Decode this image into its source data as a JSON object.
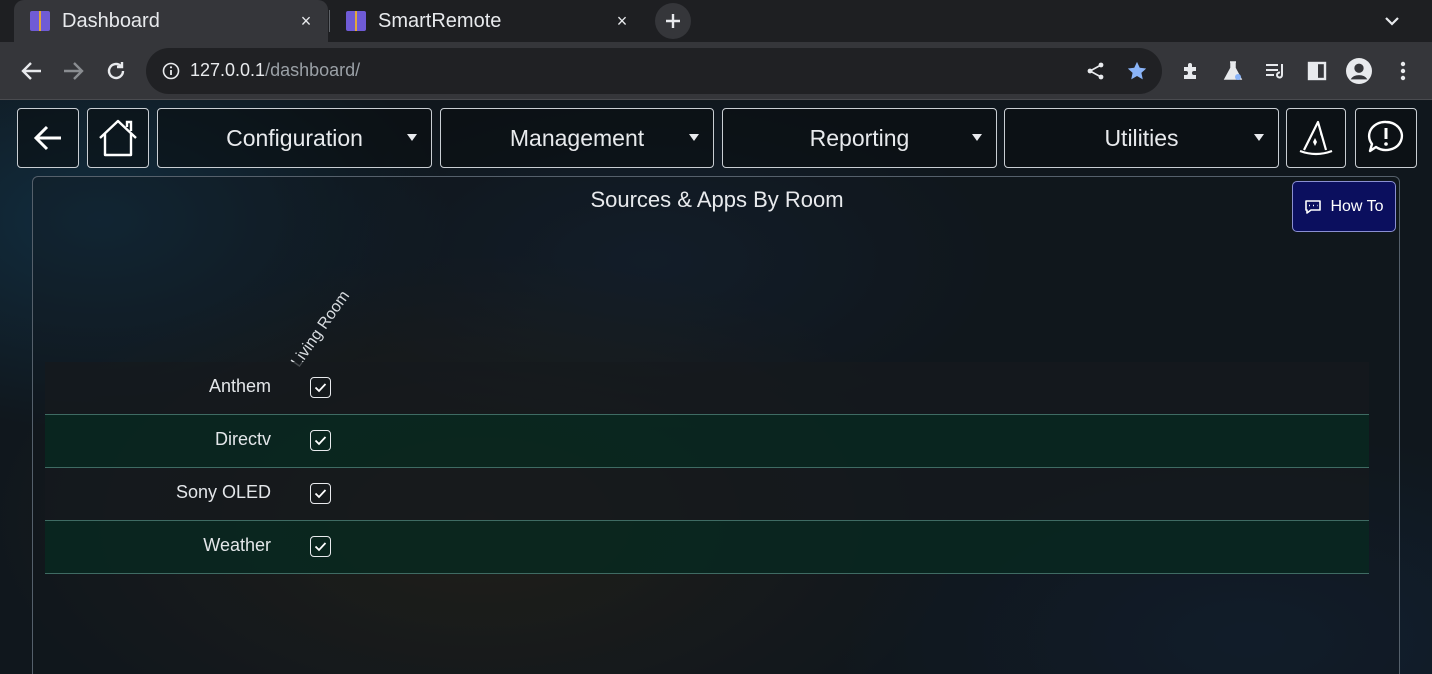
{
  "browser": {
    "tabs": [
      {
        "title": "Dashboard",
        "active": true
      },
      {
        "title": "SmartRemote",
        "active": false
      }
    ],
    "close_glyph": "×",
    "url_host": "127.0.0.1",
    "url_path": "/dashboard/"
  },
  "appnav": {
    "menus": [
      {
        "label": "Configuration"
      },
      {
        "label": "Management"
      },
      {
        "label": "Reporting"
      },
      {
        "label": "Utilities"
      }
    ]
  },
  "panel": {
    "title": "Sources & Apps By Room",
    "howto_label": "How To",
    "column_header": "Living Room",
    "rows": [
      {
        "label": "Anthem",
        "checked": true
      },
      {
        "label": "Directv",
        "checked": true
      },
      {
        "label": "Sony OLED",
        "checked": true
      },
      {
        "label": "Weather",
        "checked": true
      }
    ]
  },
  "colors": {
    "howto_bg": "#0b0f5e",
    "row_alt_bg": "#08281f",
    "star_accent": "#8ab4f8"
  }
}
